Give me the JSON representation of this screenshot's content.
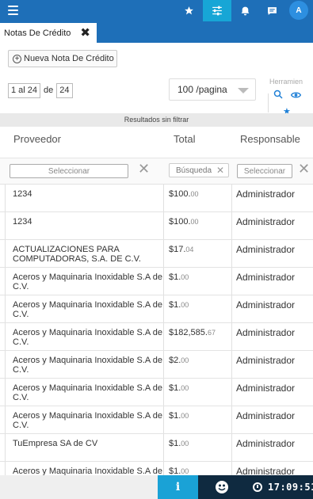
{
  "topbar": {
    "avatar_letter": "A",
    "icons": [
      "menu-icon",
      "star-icon",
      "sliders-icon",
      "bell-icon",
      "chat-icon"
    ]
  },
  "tab": {
    "label": "Notas De Crédito",
    "close": "✖"
  },
  "toolbar": {
    "new_label": "Nueva Nota De Crédito"
  },
  "pager": {
    "range": "1 al 24",
    "of_label": "de",
    "total": "24"
  },
  "per_page": {
    "selected": "100 /pagina"
  },
  "tools": {
    "label": "Herramien"
  },
  "filter_status": "Resultados sin filtrar",
  "table": {
    "headers": [
      "Proveedor",
      "Total",
      "Responsable"
    ],
    "filters": {
      "proveedor_placeholder": "Seleccionar",
      "total_placeholder": "Búsqueda",
      "responsable_placeholder": "Seleccionar"
    },
    "rows": [
      {
        "proveedor": "1234",
        "total_main": "$100.",
        "total_cents": "00",
        "responsable": "Administrador"
      },
      {
        "proveedor": "1234",
        "total_main": "$100.",
        "total_cents": "00",
        "responsable": "Administrador"
      },
      {
        "proveedor": "ACTUALIZACIONES PARA COMPUTADORAS, S.A. DE C.V.",
        "total_main": "$17.",
        "total_cents": "04",
        "responsable": "Administrador"
      },
      {
        "proveedor": "Aceros y Maquinaria Inoxidable S.A de C.V.",
        "total_main": "$1.",
        "total_cents": "00",
        "responsable": "Administrador"
      },
      {
        "proveedor": "Aceros y Maquinaria Inoxidable S.A de C.V.",
        "total_main": "$1.",
        "total_cents": "00",
        "responsable": "Administrador"
      },
      {
        "proveedor": "Aceros y Maquinaria Inoxidable S.A de C.V.",
        "total_main": "$182,585.",
        "total_cents": "67",
        "responsable": "Administrador"
      },
      {
        "proveedor": "Aceros y Maquinaria Inoxidable S.A de C.V.",
        "total_main": "$2.",
        "total_cents": "00",
        "responsable": "Administrador"
      },
      {
        "proveedor": "Aceros y Maquinaria Inoxidable S.A de C.V.",
        "total_main": "$1.",
        "total_cents": "00",
        "responsable": "Administrador"
      },
      {
        "proveedor": "Aceros y Maquinaria Inoxidable S.A de C.V.",
        "total_main": "$1.",
        "total_cents": "00",
        "responsable": "Administrador"
      },
      {
        "proveedor": "TuEmpresa SA de CV",
        "total_main": "$1.",
        "total_cents": "00",
        "responsable": "Administrador"
      },
      {
        "proveedor": "Aceros y Maquinaria Inoxidable S.A de C.V.",
        "total_main": "$1.",
        "total_cents": "00",
        "responsable": "Administrador"
      }
    ]
  },
  "bottombar": {
    "info": "i",
    "clock": "17:09:51"
  },
  "colors": {
    "primary": "#1e6fb8",
    "accent": "#17a6d6",
    "dark": "#0f2a40"
  }
}
